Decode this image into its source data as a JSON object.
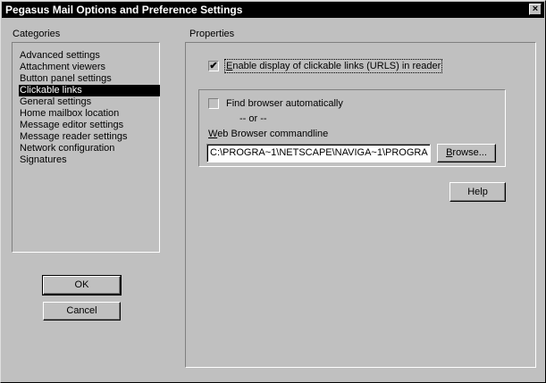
{
  "window": {
    "title": "Pegasus Mail Options and Preference Settings",
    "close_glyph": "×"
  },
  "categories": {
    "label": "Categories",
    "items": [
      {
        "label": "Advanced settings",
        "selected": false
      },
      {
        "label": "Attachment viewers",
        "selected": false
      },
      {
        "label": "Button panel settings",
        "selected": false
      },
      {
        "label": "Clickable links",
        "selected": true
      },
      {
        "label": "General settings",
        "selected": false
      },
      {
        "label": "Home mailbox location",
        "selected": false
      },
      {
        "label": "Message editor settings",
        "selected": false
      },
      {
        "label": "Message reader settings",
        "selected": false
      },
      {
        "label": "Network configuration",
        "selected": false
      },
      {
        "label": "Signatures",
        "selected": false
      }
    ]
  },
  "buttons": {
    "ok": "OK",
    "cancel": "Cancel",
    "browse_first": "B",
    "browse_rest": "rowse...",
    "help": "Help"
  },
  "properties": {
    "label": "Properties",
    "enable_links": {
      "first": "E",
      "rest": "nable display of clickable links (URLS) in reader",
      "checked": true,
      "check_glyph": "✔"
    },
    "find_browser": {
      "label": "Find browser automatically",
      "checked": false
    },
    "or_text": "-- or --",
    "cmdline_label_first": "W",
    "cmdline_label_rest": "eb Browser commandline",
    "cmdline_value": "C:\\PROGRA~1\\NETSCAPE\\NAVIGA~1\\PROGRA"
  }
}
